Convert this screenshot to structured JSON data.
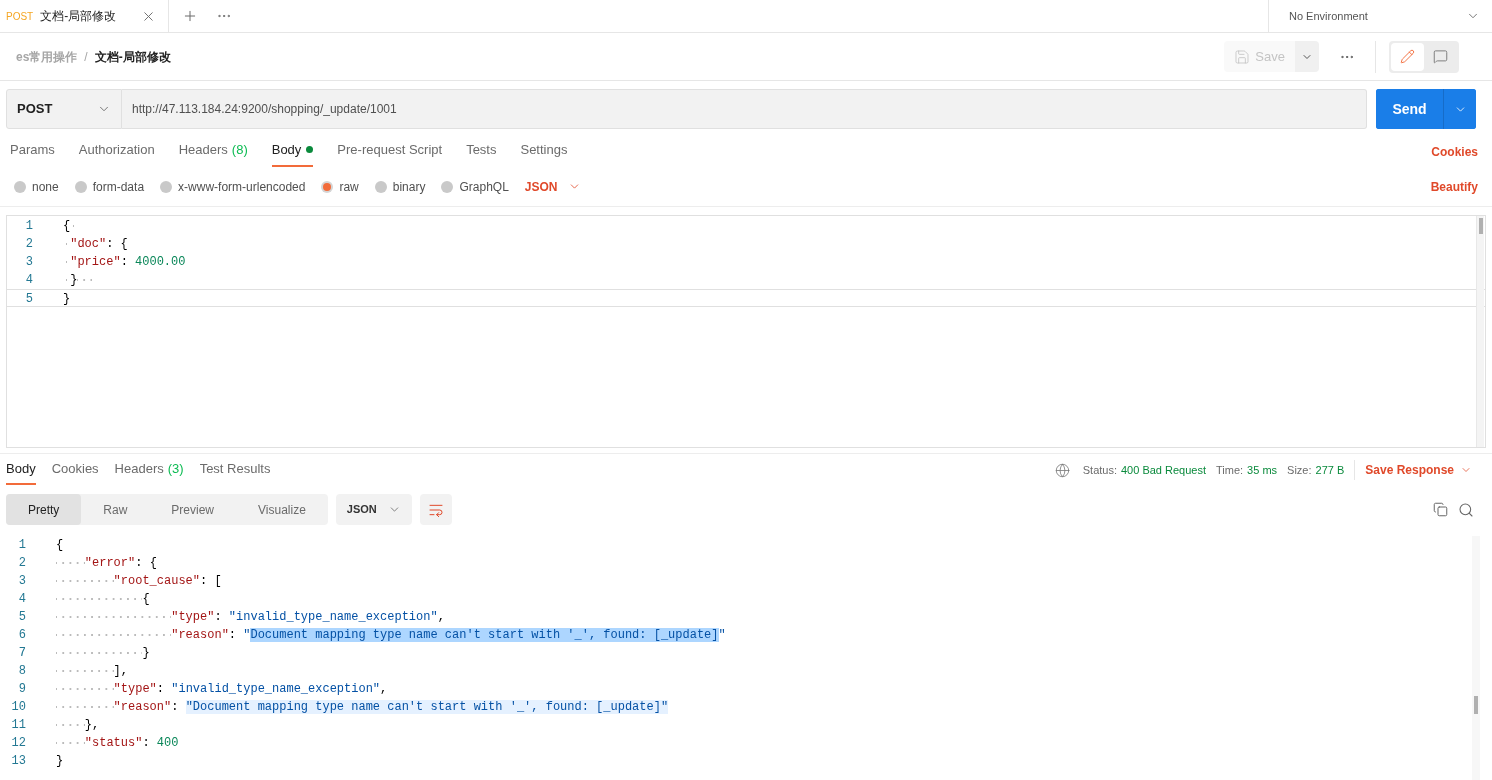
{
  "tab": {
    "method": "POST",
    "title": "文档-局部修改"
  },
  "environment": "No Environment",
  "breadcrumb": {
    "collection": "es常用操作",
    "separator": "/",
    "request": "文档-局部修改"
  },
  "save_button": {
    "label": "Save",
    "disabled": true
  },
  "view_toggle": [
    {
      "kind": "edit",
      "selected": true
    },
    {
      "kind": "comments",
      "selected": false
    }
  ],
  "request": {
    "method": "POST",
    "url": "http://47.113.184.24:9200/shopping/_update/1001"
  },
  "send_button": "Send",
  "request_tabs": [
    {
      "label": "Params",
      "selected": false,
      "dot": false
    },
    {
      "label": "Authorization",
      "selected": false,
      "dot": false
    },
    {
      "label": "Headers",
      "count": "(8)",
      "selected": false,
      "dot": false
    },
    {
      "label": "Body",
      "selected": true,
      "dot": true
    },
    {
      "label": "Pre-request Script",
      "selected": false,
      "dot": false
    },
    {
      "label": "Tests",
      "selected": false,
      "dot": false
    },
    {
      "label": "Settings",
      "selected": false,
      "dot": false
    }
  ],
  "cookies_link": "Cookies",
  "body_types": [
    {
      "label": "none",
      "selected": false
    },
    {
      "label": "form-data",
      "selected": false
    },
    {
      "label": "x-www-form-urlencoded",
      "selected": false
    },
    {
      "label": "raw",
      "selected": true
    },
    {
      "label": "binary",
      "selected": false
    },
    {
      "label": "GraphQL",
      "selected": false
    }
  ],
  "body_format": "JSON",
  "beautify": "Beautify",
  "request_body": [
    {
      "number": "1",
      "current": false,
      "tokens": [
        {
          "kind": "punct",
          "text": "{ "
        }
      ]
    },
    {
      "number": "2",
      "current": false,
      "tokens": [
        {
          "kind": "key",
          "text": " \"doc\""
        },
        {
          "kind": "punct",
          "text": ": {"
        }
      ]
    },
    {
      "number": "3",
      "current": false,
      "tokens": [
        {
          "kind": "key",
          "text": " \"price\""
        },
        {
          "kind": "punct",
          "text": ": "
        },
        {
          "kind": "number",
          "text": "4000.00"
        }
      ]
    },
    {
      "number": "4",
      "current": false,
      "tokens": [
        {
          "kind": "punct",
          "text": " }  "
        }
      ]
    },
    {
      "number": "5",
      "current": true,
      "tokens": [
        {
          "kind": "punct",
          "text": "}"
        }
      ]
    }
  ],
  "response_tabs": [
    {
      "label": "Body",
      "selected": true
    },
    {
      "label": "Cookies",
      "selected": false
    },
    {
      "label": "Headers",
      "count": "(3)",
      "selected": false
    },
    {
      "label": "Test Results",
      "selected": false
    }
  ],
  "status": {
    "label": "Status:",
    "value": "400 Bad Request"
  },
  "time": {
    "label": "Time:",
    "value": "35 ms"
  },
  "size": {
    "label": "Size:",
    "value": "277 B"
  },
  "save_response": "Save Response",
  "view_modes": [
    {
      "label": "Pretty",
      "selected": true
    },
    {
      "label": "Raw",
      "selected": false
    },
    {
      "label": "Preview",
      "selected": false
    },
    {
      "label": "Visualize",
      "selected": false
    }
  ],
  "response_format": "JSON",
  "response_body": [
    {
      "number": "1",
      "tokens": [
        {
          "kind": "punct",
          "text": "{"
        }
      ]
    },
    {
      "number": "2",
      "tokens": [
        {
          "kind": "key",
          "text": "    \"error\""
        },
        {
          "kind": "punct",
          "text": ": {"
        }
      ]
    },
    {
      "number": "3",
      "tokens": [
        {
          "kind": "key",
          "text": "        \"root_cause\""
        },
        {
          "kind": "punct",
          "text": ": ["
        }
      ]
    },
    {
      "number": "4",
      "tokens": [
        {
          "kind": "punct",
          "text": "            {"
        }
      ]
    },
    {
      "number": "5",
      "tokens": [
        {
          "kind": "key",
          "text": "                \"type\""
        },
        {
          "kind": "punct",
          "text": ": "
        },
        {
          "kind": "string",
          "text": "\"invalid_type_name_exception\""
        },
        {
          "kind": "punct",
          "text": ","
        }
      ]
    },
    {
      "number": "6",
      "tokens": [
        {
          "kind": "key",
          "text": "                \"reason\""
        },
        {
          "kind": "punct",
          "text": ": "
        },
        {
          "kind": "string",
          "text": "\""
        },
        {
          "kind": "string-selected",
          "text": "Document mapping type name can't start with '_', found: [_update]"
        },
        {
          "kind": "string",
          "text": "\""
        }
      ]
    },
    {
      "number": "7",
      "tokens": [
        {
          "kind": "punct",
          "text": "            }"
        }
      ]
    },
    {
      "number": "8",
      "tokens": [
        {
          "kind": "punct",
          "text": "        ],"
        }
      ]
    },
    {
      "number": "9",
      "tokens": [
        {
          "kind": "key",
          "text": "        \"type\""
        },
        {
          "kind": "punct",
          "text": ": "
        },
        {
          "kind": "string",
          "text": "\"invalid_type_name_exception\""
        },
        {
          "kind": "punct",
          "text": ","
        }
      ]
    },
    {
      "number": "10",
      "tokens": [
        {
          "kind": "key",
          "text": "        \"reason\""
        },
        {
          "kind": "punct",
          "text": ": "
        },
        {
          "kind": "string-match",
          "text": "\"Document mapping type name can't start with '_', found: [_update]\""
        }
      ]
    },
    {
      "number": "11",
      "tokens": [
        {
          "kind": "punct",
          "text": "    },"
        }
      ]
    },
    {
      "number": "12",
      "tokens": [
        {
          "kind": "key",
          "text": "    \"status\""
        },
        {
          "kind": "punct",
          "text": ": "
        },
        {
          "kind": "number",
          "text": "400"
        }
      ]
    },
    {
      "number": "13",
      "tokens": [
        {
          "kind": "punct",
          "text": "}"
        }
      ]
    }
  ]
}
